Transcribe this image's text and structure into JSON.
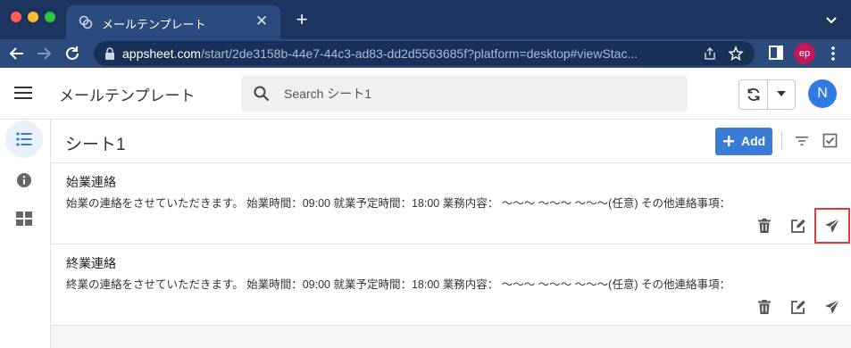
{
  "browser": {
    "tab_title": "メールテンプレート",
    "url_domain": "appsheet.com",
    "url_rest": "/start/2de3158b-44e7-44c3-ad83-dd2d5563685f?platform=desktop#viewStac...",
    "profile_initials": "ep",
    "new_tab_label": "+",
    "close_tab_label": "✕"
  },
  "app": {
    "title": "メールテンプレート",
    "search_placeholder": "Search シート1",
    "avatar_initial": "N"
  },
  "sidebar": {
    "items": [
      {
        "icon": "list-icon",
        "active": true
      },
      {
        "icon": "info-icon",
        "active": false
      },
      {
        "icon": "dashboard-icon",
        "active": false
      }
    ]
  },
  "view": {
    "title": "シート1",
    "add_label": "Add",
    "records": [
      {
        "title": "始業連絡",
        "body": "始業の連絡をさせていただきます。 始業時間：09:00 就業予定時間：18:00 業務内容： 〜〜〜 〜〜〜 〜〜〜(任意) その他連絡事項：",
        "send_highlighted": true
      },
      {
        "title": "終業連絡",
        "body": "終業の連絡をさせていただきます。 始業時間：09:00 就業予定時間：18:00 業務内容： 〜〜〜 〜〜〜 〜〜〜(任意) その他連絡事項：",
        "send_highlighted": false
      }
    ]
  },
  "colors": {
    "browser_frame": "#1d355e",
    "accent": "#3a7bd5",
    "avatar": "#2f7de1",
    "highlight": "#e53935"
  }
}
